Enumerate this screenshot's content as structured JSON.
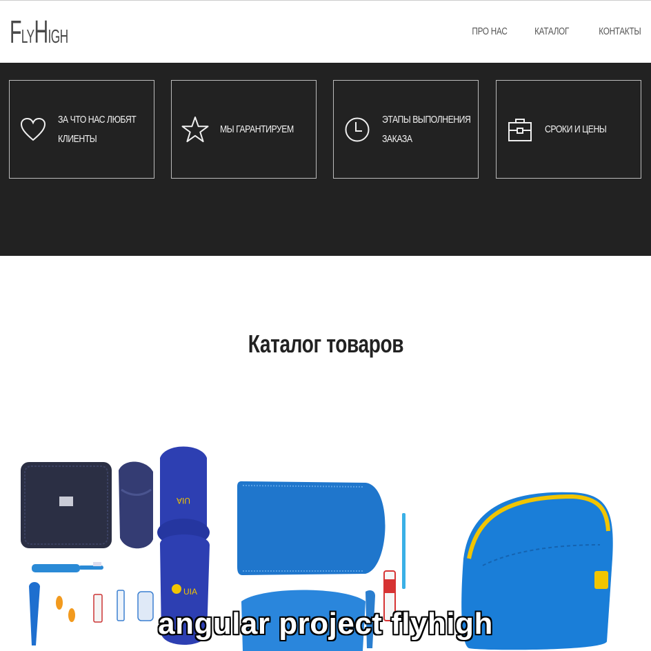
{
  "header": {
    "logo_big_1": "F",
    "logo_small_1": "LY",
    "logo_big_2": "H",
    "logo_small_2": "IGH",
    "nav": [
      "ПРО НАС",
      "КАТАЛОГ",
      "КОНТАКТЫ"
    ]
  },
  "features": [
    {
      "icon": "heart-icon",
      "line1": "ЗА ЧТО НАС ЛЮБЯТ",
      "line2": "КЛИЕНТЫ"
    },
    {
      "icon": "star-icon",
      "line1": "МЫ ГАРАНТИРУЕМ",
      "line2": ""
    },
    {
      "icon": "clock-icon",
      "line1": "ЭТАПЫ ВЫПОЛНЕНИЯ",
      "line2": "ЗАКАЗА"
    },
    {
      "icon": "briefcase-icon",
      "line1": "СРОКИ И ЦЕНЫ",
      "line2": ""
    }
  ],
  "catalog": {
    "title": "Каталог товаров"
  },
  "products": [
    {
      "brand_label": "UIA"
    },
    {
      "brand_label": "UIA"
    }
  ],
  "caption": "angular project flyhigh",
  "colors": {
    "band": "#222222",
    "navy": "#2d3a6e",
    "blue": "#1e7fcf",
    "yellow": "#f2c500"
  }
}
